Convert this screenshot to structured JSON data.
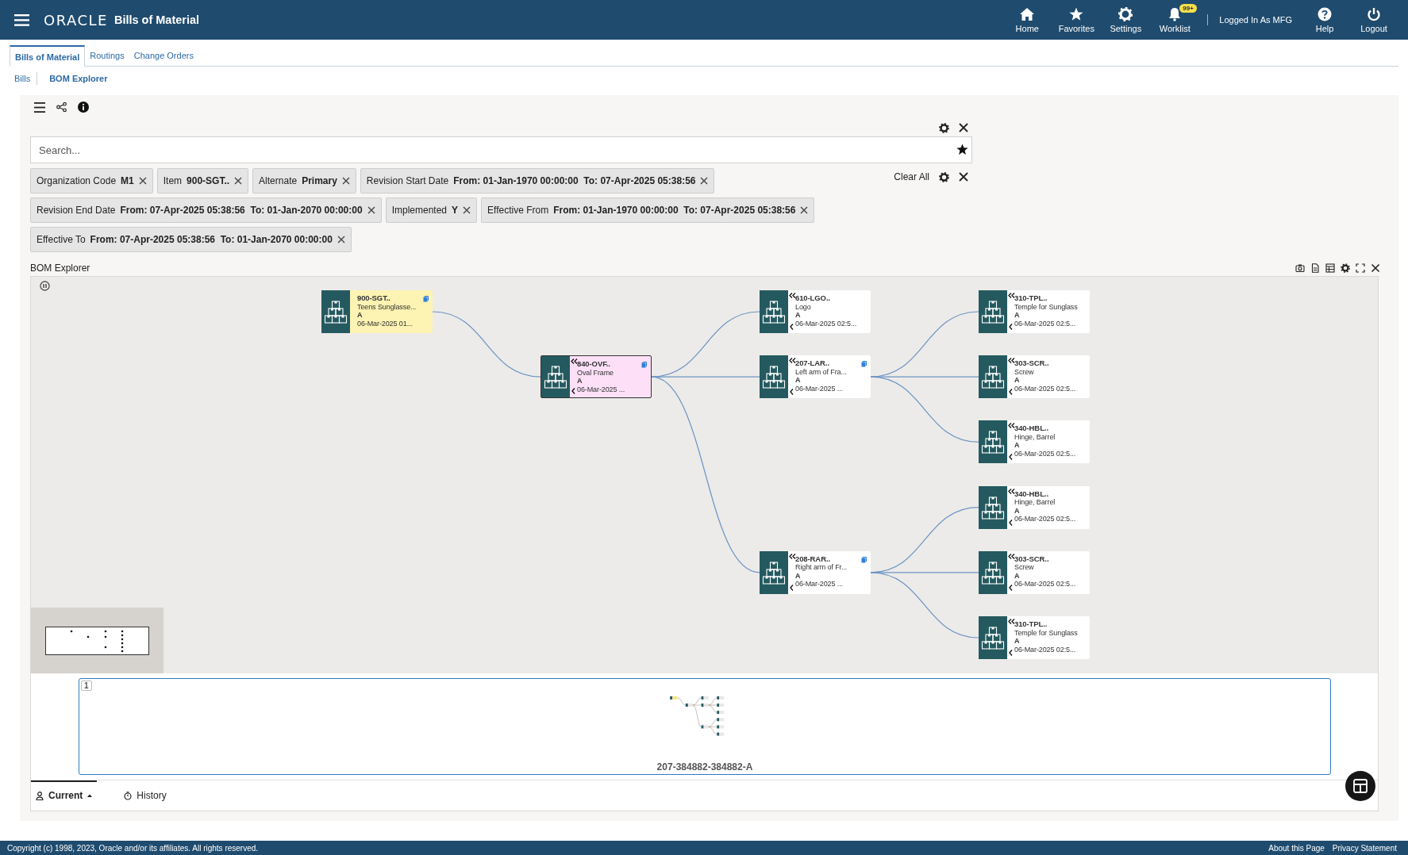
{
  "app": {
    "brand": "ORACLE",
    "title": "Bills of Material"
  },
  "header_actions": [
    {
      "kind": "home",
      "label": "Home"
    },
    {
      "kind": "favorites",
      "label": "Favorites"
    },
    {
      "kind": "settings",
      "label": "Settings"
    },
    {
      "kind": "worklist",
      "label": "Worklist",
      "badge": "99+"
    }
  ],
  "user": "Logged In As MFG",
  "header_utilities": [
    {
      "kind": "help",
      "label": "Help"
    },
    {
      "kind": "logout",
      "label": "Logout"
    }
  ],
  "tabs": [
    {
      "label": "Bills of Material",
      "selected": true
    },
    {
      "label": "Routings",
      "selected": false
    },
    {
      "label": "Change Orders",
      "selected": false
    }
  ],
  "subtabs": [
    {
      "label": "Bills",
      "selected": false
    },
    {
      "label": "BOM Explorer",
      "selected": true
    }
  ],
  "search": {
    "placeholder": "Search..."
  },
  "filters": [
    {
      "label": "Organization Code",
      "value": "M1"
    },
    {
      "label": "Item",
      "value": "900-SGT.."
    },
    {
      "label": "Alternate",
      "value": "Primary"
    },
    {
      "label": "Revision Start Date",
      "value": "From: 01-Jan-1970 00:00:00  To: 07-Apr-2025 05:38:56"
    },
    {
      "label": "Revision End Date",
      "value": "From: 07-Apr-2025 05:38:56  To: 01-Jan-2070 00:00:00"
    },
    {
      "label": "Implemented",
      "value": "Y"
    },
    {
      "label": "Effective From",
      "value": "From: 01-Jan-1970 00:00:00  To: 07-Apr-2025 05:38:56"
    },
    {
      "label": "Effective To",
      "value": "From: 07-Apr-2025 05:38:56  To: 01-Jan-2070 00:00:00"
    }
  ],
  "clear_all": "Clear All",
  "explorer": {
    "title": "BOM Explorer",
    "tree": {
      "code": "900-SGT..",
      "name": "Teens Sunglasse...",
      "revision": "A",
      "date": "06-Mar-2025 01...",
      "kind": "root",
      "selected": false,
      "attachment": true,
      "children": [
        {
          "code": "840-OVF..",
          "name": "Oval Frame",
          "revision": "A",
          "date": "06-Mar-2025 ...",
          "kind": "item",
          "selected": true,
          "attachment": true,
          "children": [
            {
              "code": "610-LGO..",
              "name": "Logo",
              "revision": "A",
              "date": "06-Mar-2025 02:5...",
              "kind": "item",
              "selected": false,
              "attachment": false
            },
            {
              "code": "207-LAR..",
              "name": "Left arm of Fra...",
              "revision": "A",
              "date": "06-Mar-2025 ...",
              "kind": "item",
              "selected": false,
              "attachment": true,
              "children": [
                {
                  "code": "310-TPL..",
                  "name": "Temple for Sunglass",
                  "revision": "A",
                  "date": "06-Mar-2025 02:5...",
                  "kind": "item",
                  "selected": false,
                  "attachment": false
                },
                {
                  "code": "303-SCR..",
                  "name": "Screw",
                  "revision": "A",
                  "date": "06-Mar-2025 02:5...",
                  "kind": "item",
                  "selected": false,
                  "attachment": false
                },
                {
                  "code": "340-HBL..",
                  "name": "Hinge, Barrel",
                  "revision": "A",
                  "date": "06-Mar-2025 02:5...",
                  "kind": "item",
                  "selected": false,
                  "attachment": false
                }
              ]
            },
            {
              "code": "208-RAR..",
              "name": "Right arm of Fr...",
              "revision": "A",
              "date": "06-Mar-2025 ...",
              "kind": "item",
              "selected": false,
              "attachment": true,
              "children": [
                {
                  "code": "340-HBL..",
                  "name": "Hinge, Barrel",
                  "revision": "A",
                  "date": "06-Mar-2025 02:5...",
                  "kind": "item",
                  "selected": false,
                  "attachment": false
                },
                {
                  "code": "303-SCR..",
                  "name": "Screw",
                  "revision": "A",
                  "date": "06-Mar-2025 02:5...",
                  "kind": "item",
                  "selected": false,
                  "attachment": false
                },
                {
                  "code": "310-TPL..",
                  "name": "Temple for Sunglass",
                  "revision": "A",
                  "date": "06-Mar-2025 02:5...",
                  "kind": "item",
                  "selected": false,
                  "attachment": false
                }
              ]
            }
          ]
        }
      ]
    },
    "thumbnail": {
      "page": "1",
      "caption": "207-384882-384882-A"
    }
  },
  "bottom_tabs": [
    {
      "kind": "current",
      "label": "Current",
      "selected": true
    },
    {
      "kind": "history",
      "label": "History",
      "selected": false
    }
  ],
  "footer": {
    "copyright": "Copyright (c) 1998, 2023, Oracle and/or its affiliates. All rights reserved.",
    "links": [
      "About this Page",
      "Privacy Statement"
    ]
  }
}
